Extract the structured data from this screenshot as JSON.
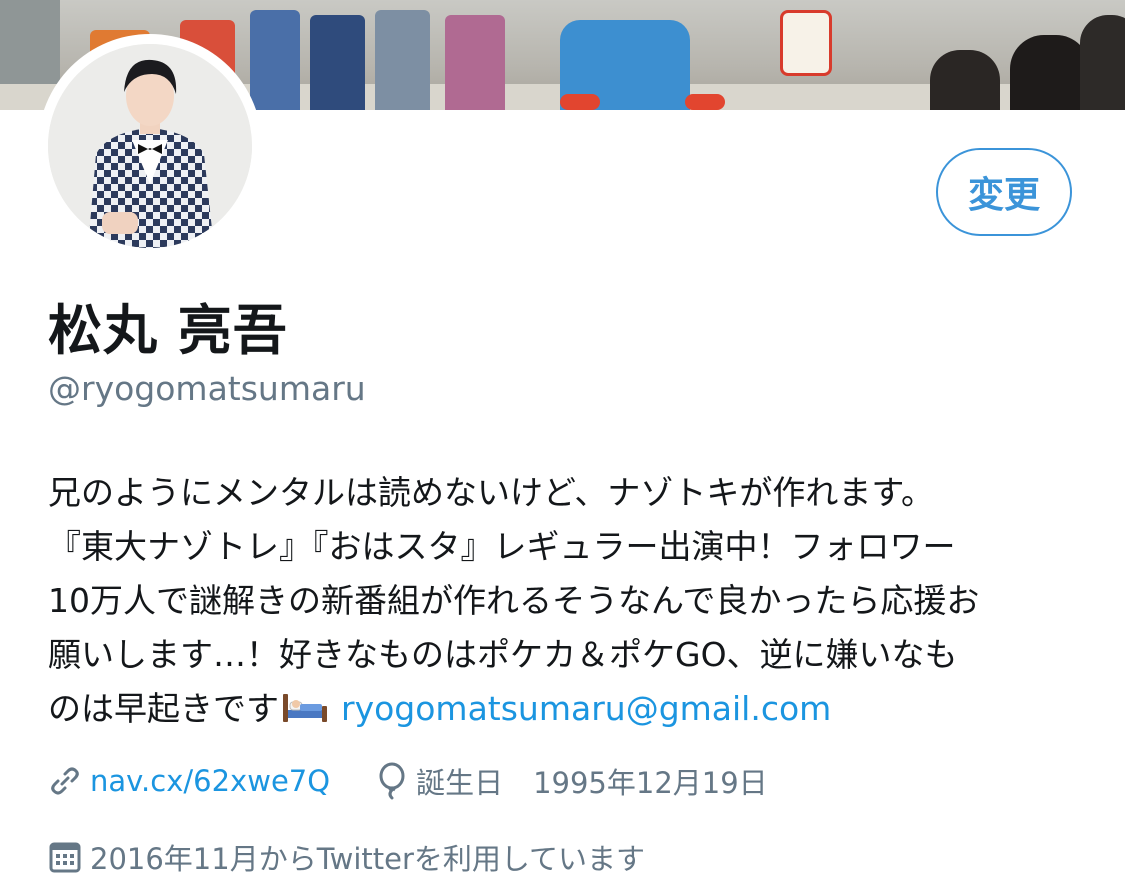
{
  "profile": {
    "display_name": "松丸 亮吾",
    "handle": "@ryogomatsumaru",
    "edit_button_label": "変更",
    "bio_lines": [
      "兄のようにメンタルは読めないけど、ナゾトキが作れます。",
      "『東大ナゾトレ』『おはスタ』レギュラー出演中！フォロワー",
      "10万人で謎解きの新番組が作れるそうなんで良かったら応援お",
      "願いします…！好きなものはポケカ＆ポケGO、逆に嫌いなも"
    ],
    "bio_last_line_text": "のは早起きです",
    "bio_email": "ryogomatsumaru@gmail.com",
    "website": "nav.cx/62xwe7Q",
    "birthday_label": "誕生日",
    "birthday_value": "1995年12月19日",
    "joined": "2016年11月からTwitterを利用しています"
  },
  "icons": {
    "bed": "bed-emoji-icon",
    "link": "link-icon",
    "birthday": "balloon-icon",
    "calendar": "calendar-icon"
  },
  "colors": {
    "accent": "#1b95e0",
    "button_border": "#3b94d9",
    "secondary_text": "#657786"
  }
}
